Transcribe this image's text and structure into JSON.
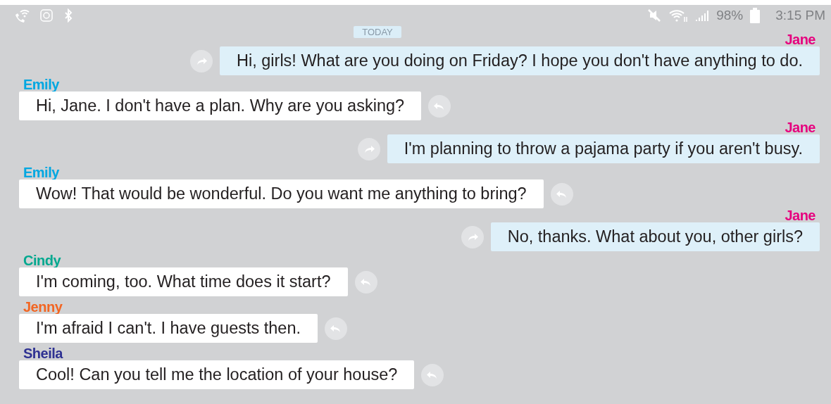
{
  "status_bar": {
    "battery": "98%",
    "time": "3:15 PM"
  },
  "date_label": "TODAY",
  "messages": [
    {
      "kind": "out",
      "sender": "Jane",
      "color": "#e6007e",
      "text": "Hi, girls! What are you doing on Friday? I hope you don't have anything to do."
    },
    {
      "kind": "in",
      "sender": "Emily",
      "color": "#00a7e1",
      "text": "Hi, Jane. I don't have a plan. Why are you asking?"
    },
    {
      "kind": "out",
      "sender": "Jane",
      "color": "#e6007e",
      "text": "I'm planning to throw a pajama party if you aren't busy."
    },
    {
      "kind": "in",
      "sender": "Emily",
      "color": "#00a7e1",
      "text": "Wow! That would be wonderful. Do you want me anything to bring?"
    },
    {
      "kind": "out",
      "sender": "Jane",
      "color": "#e6007e",
      "text": "No, thanks. What about you, other girls?"
    },
    {
      "kind": "in",
      "sender": "Cindy",
      "color": "#00a88f",
      "text": "I'm coming, too. What time does it start?"
    },
    {
      "kind": "in",
      "sender": "Jenny",
      "color": "#f26522",
      "text": "I'm afraid I can't. I have guests then."
    },
    {
      "kind": "in",
      "sender": "Sheila",
      "color": "#2e3192",
      "text": "Cool! Can you tell me the location of your house?"
    }
  ]
}
